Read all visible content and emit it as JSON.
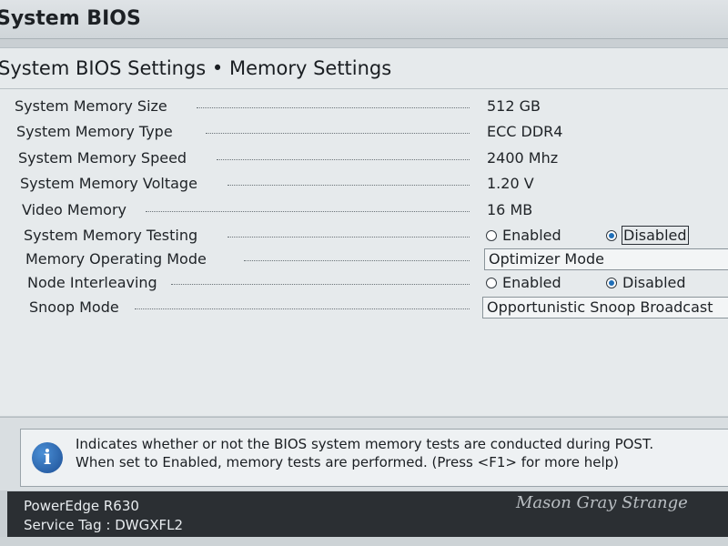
{
  "window": {
    "title": "System BIOS"
  },
  "page": {
    "breadcrumb": "System BIOS Settings • Memory Settings"
  },
  "settings": {
    "memory_size": {
      "label": "System Memory Size",
      "value": "512 GB"
    },
    "memory_type": {
      "label": "System Memory Type",
      "value": "ECC DDR4"
    },
    "memory_speed": {
      "label": "System Memory Speed",
      "value": "2400 Mhz"
    },
    "memory_voltage": {
      "label": "System Memory Voltage",
      "value": "1.20 V"
    },
    "video_memory": {
      "label": "Video Memory",
      "value": "16 MB"
    },
    "memory_testing": {
      "label": "System Memory Testing",
      "option_enabled": "Enabled",
      "option_disabled": "Disabled",
      "selected": "Disabled"
    },
    "operating_mode": {
      "label": "Memory Operating Mode",
      "value": "Optimizer Mode"
    },
    "node_interleaving": {
      "label": "Node Interleaving",
      "option_enabled": "Enabled",
      "option_disabled": "Disabled",
      "selected": "Disabled"
    },
    "snoop_mode": {
      "label": "Snoop Mode",
      "value": "Opportunistic Snoop Broadcast"
    }
  },
  "help": {
    "line1": "Indicates whether or not the BIOS system memory tests are conducted during POST.",
    "line2": "When set to Enabled, memory tests are performed. (Press <F1> for more help)"
  },
  "footer": {
    "model": "PowerEdge R630",
    "service_tag": "Service Tag : DWGXFL2"
  },
  "watermark": "Mason Gray Strange",
  "colors": {
    "accent": "#1f6fb8",
    "footer_bg": "#2b2f33",
    "panel_bg": "#e6eaec"
  }
}
